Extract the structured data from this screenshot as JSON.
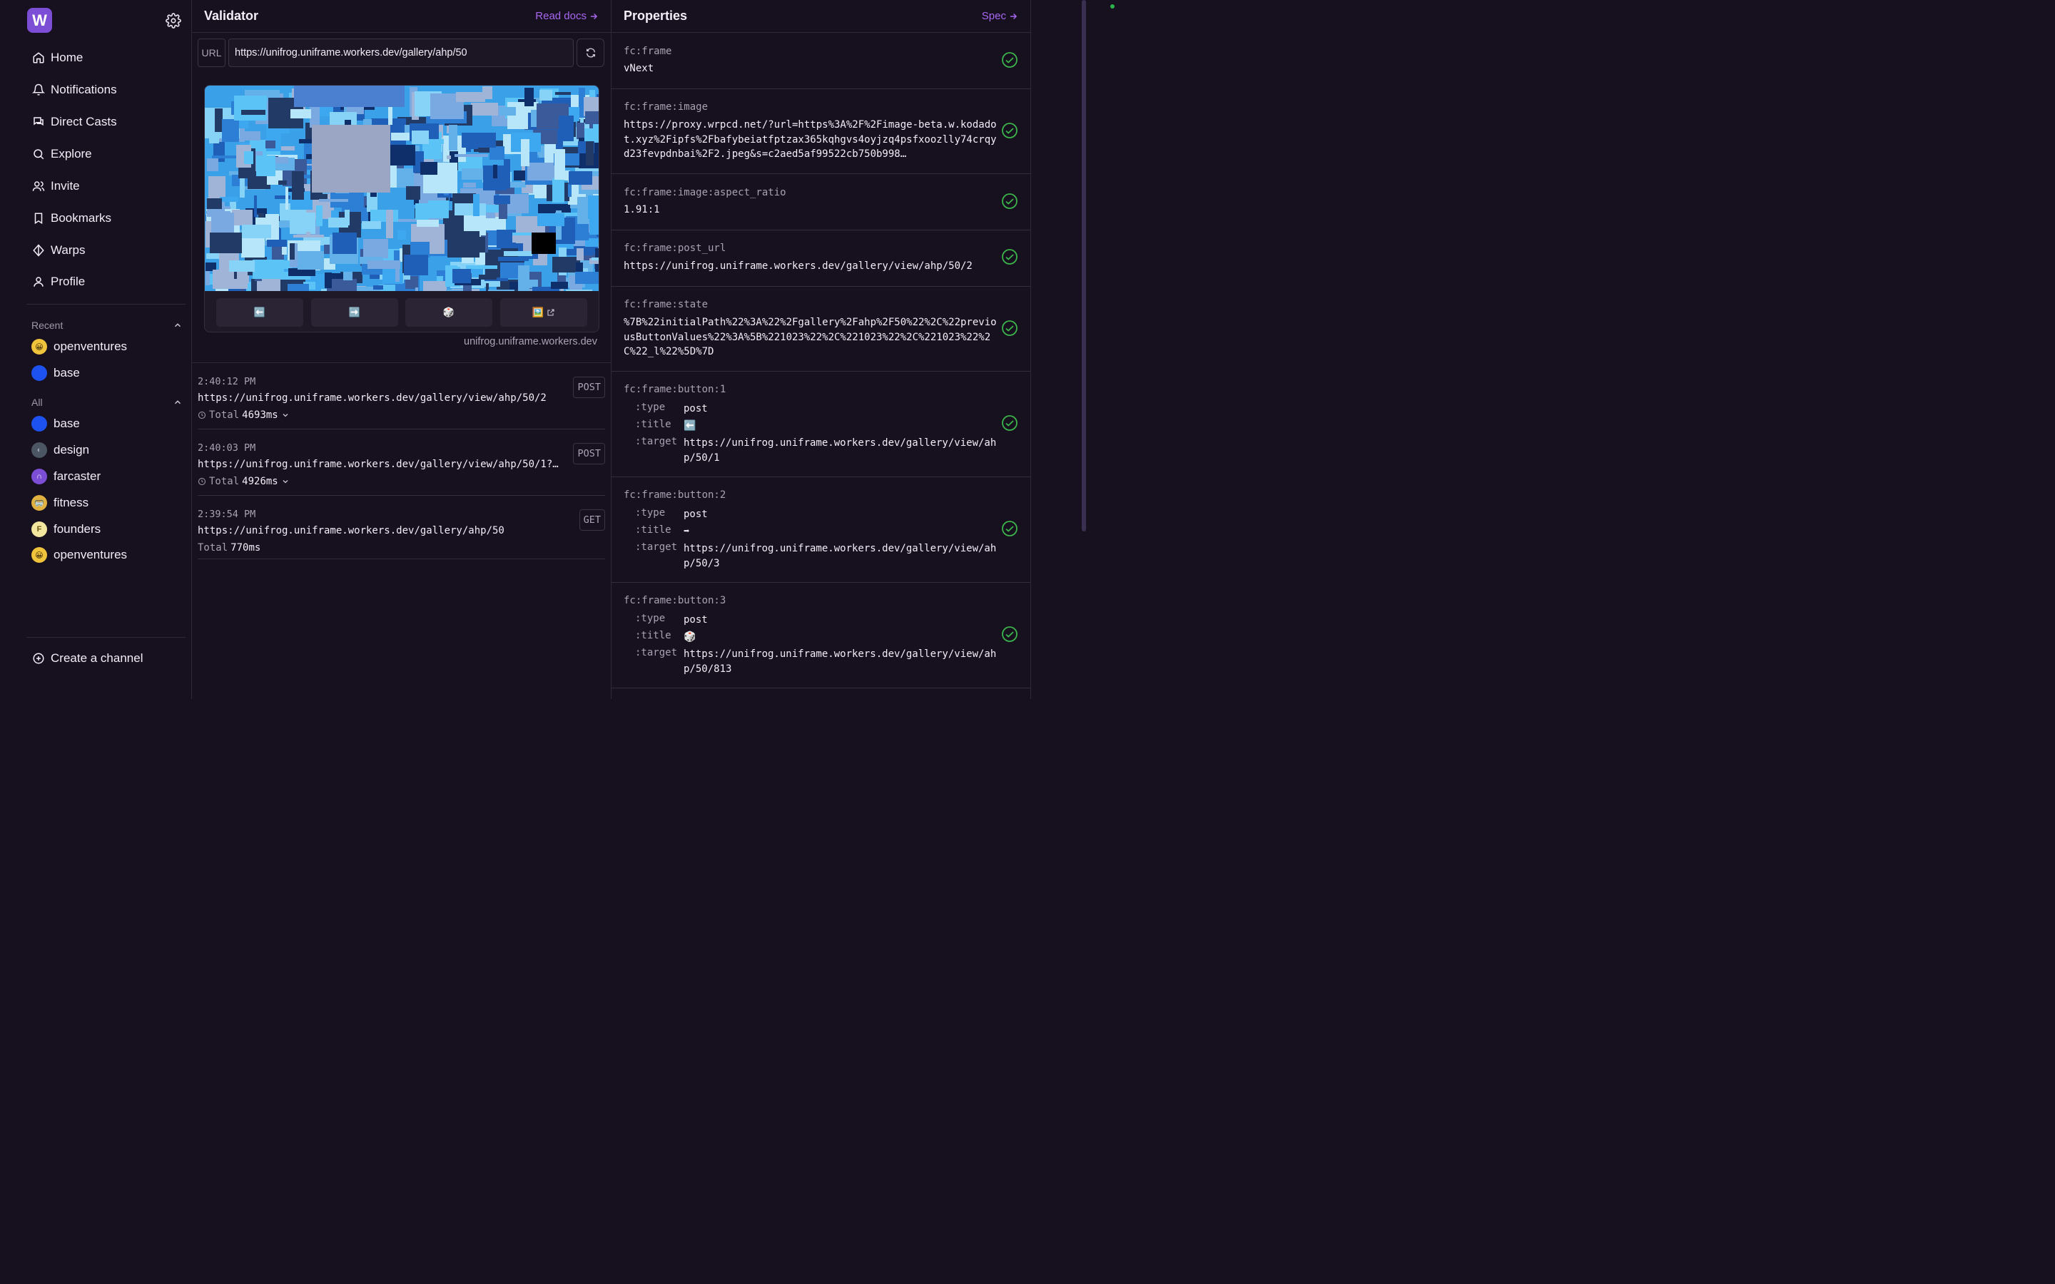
{
  "sidebar": {
    "logo": "W",
    "nav": [
      {
        "label": "Home",
        "icon": "home-icon"
      },
      {
        "label": "Notifications",
        "icon": "bell-icon"
      },
      {
        "label": "Direct Casts",
        "icon": "chat-icon"
      },
      {
        "label": "Explore",
        "icon": "search-icon"
      },
      {
        "label": "Invite",
        "icon": "users-icon"
      },
      {
        "label": "Bookmarks",
        "icon": "bookmark-icon"
      },
      {
        "label": "Warps",
        "icon": "diamond-icon"
      },
      {
        "label": "Profile",
        "icon": "user-icon"
      }
    ],
    "recent_label": "Recent",
    "recent": [
      {
        "name": "openventures",
        "color": "#f0c33c"
      },
      {
        "name": "base",
        "color": "#1d52f0"
      }
    ],
    "all_label": "All",
    "all": [
      {
        "name": "base",
        "color": "#1d52f0"
      },
      {
        "name": "design",
        "color": "#4b5563"
      },
      {
        "name": "farcaster",
        "color": "#7c4ed6"
      },
      {
        "name": "fitness",
        "color": "#e0b040"
      },
      {
        "name": "founders",
        "color": "#f3e7a0"
      },
      {
        "name": "openventures",
        "color": "#f0c33c"
      }
    ],
    "create_channel": "Create a channel"
  },
  "validator": {
    "title": "Validator",
    "read_docs": "Read docs",
    "url_label": "URL",
    "url_value": "https://unifrog.uniframe.workers.dev/gallery/ahp/50",
    "buttons": [
      "⬅️",
      "➡️",
      "🎲",
      "🖼️"
    ],
    "host": "unifrog.uniframe.workers.dev",
    "logs": [
      {
        "time": "2:40:12 PM",
        "url": "https://unifrog.uniframe.workers.dev/gallery/view/ahp/50/2",
        "total_label": "Total",
        "total": "4693ms",
        "method": "POST"
      },
      {
        "time": "2:40:03 PM",
        "url": "https://unifrog.uniframe.workers.dev/gallery/view/ahp/50/1?…",
        "total_label": "Total",
        "total": "4926ms",
        "method": "POST"
      },
      {
        "time": "2:39:54 PM",
        "url": "https://unifrog.uniframe.workers.dev/gallery/ahp/50",
        "total_label": "Total",
        "total": "770ms",
        "method": "GET"
      }
    ]
  },
  "properties": {
    "title": "Properties",
    "spec": "Spec",
    "items": [
      {
        "key": "fc:frame",
        "value": "vNext"
      },
      {
        "key": "fc:frame:image",
        "value": "https://proxy.wrpcd.net/?url=https%3A%2F%2Fimage-beta.w.kodadot.xyz%2Fipfs%2Fbafybeiatfptzax365kqhgvs4oyjzq4psfxoozlly74crqyd23fevpdnbai%2F2.jpeg&s=c2aed5af99522cb750b998…"
      },
      {
        "key": "fc:frame:image:aspect_ratio",
        "value": "1.91:1"
      },
      {
        "key": "fc:frame:post_url",
        "value": "https://unifrog.uniframe.workers.dev/gallery/view/ahp/50/2"
      },
      {
        "key": "fc:frame:state",
        "value": "%7B%22initialPath%22%3A%22%2Fgallery%2Fahp%2F50%22%2C%22previousButtonValues%22%3A%5B%221023%22%2C%221023%22%2C%221023%22%2C%22_l%22%5D%7D"
      }
    ],
    "buttons": [
      {
        "key": "fc:frame:button:1",
        "type_label": ":type",
        "type": "post",
        "title_label": ":title",
        "title": "⬅️",
        "target_label": ":target",
        "target": "https://unifrog.uniframe.workers.dev/gallery/view/ahp/50/1"
      },
      {
        "key": "fc:frame:button:2",
        "type_label": ":type",
        "type": "post",
        "title_label": ":title",
        "title": "➡",
        "target_label": ":target",
        "target": "https://unifrog.uniframe.workers.dev/gallery/view/ahp/50/3"
      },
      {
        "key": "fc:frame:button:3",
        "type_label": ":type",
        "type": "post",
        "title_label": ":title",
        "title": "🎲",
        "target_label": ":target",
        "target": "https://unifrog.uniframe.workers.dev/gallery/view/ahp/50/813"
      }
    ]
  },
  "colors": {
    "accent": "#a768f0",
    "check": "#3bb54a",
    "background": "#17101f"
  }
}
